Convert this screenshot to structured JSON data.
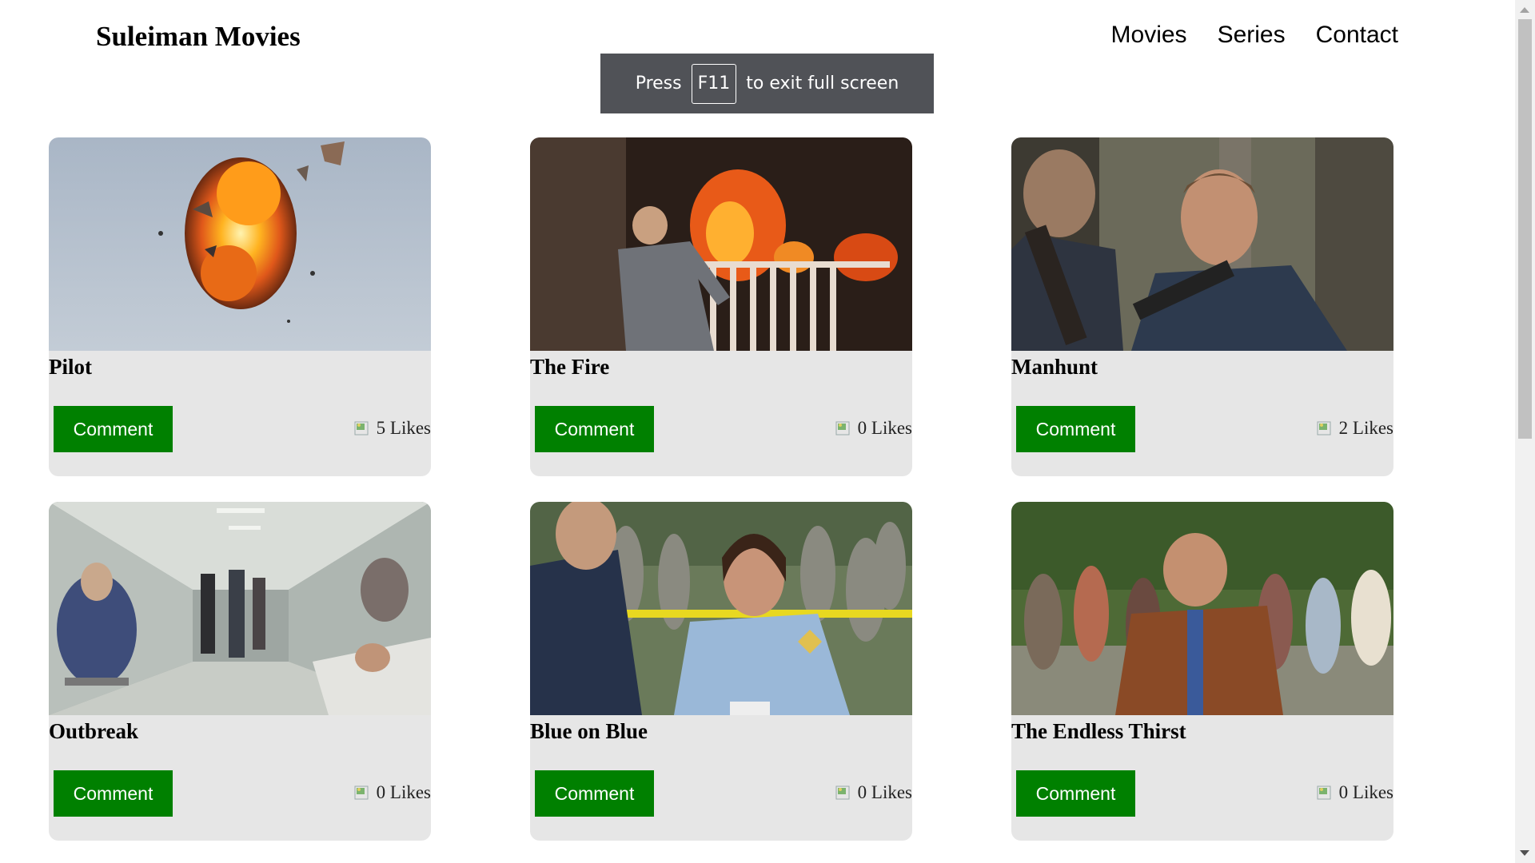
{
  "header": {
    "brand": "Suleiman Movies",
    "nav": [
      "Movies",
      "Series",
      "Contact"
    ]
  },
  "fullscreen_notice": {
    "prefix": "Press",
    "key": "F11",
    "suffix": "to exit full screen"
  },
  "episodes": [
    {
      "title": "Pilot",
      "comment_label": "Comment",
      "likes": "5 Likes",
      "image": "explosion-in-sky",
      "like_icon": "broken-image-icon"
    },
    {
      "title": "The Fire",
      "comment_label": "Comment",
      "likes": "0 Likes",
      "image": "man-by-burning-house",
      "like_icon": "broken-image-icon"
    },
    {
      "title": "Manhunt",
      "comment_label": "Comment",
      "likes": "2 Likes",
      "image": "man-with-rifle-in-woods",
      "like_icon": "broken-image-icon"
    },
    {
      "title": "Outbreak",
      "comment_label": "Comment",
      "likes": "0 Likes",
      "image": "crowded-hospital-corridor",
      "like_icon": "broken-image-icon"
    },
    {
      "title": "Blue on Blue",
      "comment_label": "Comment",
      "likes": "0 Likes",
      "image": "deputy-at-crime-tape",
      "like_icon": "broken-image-icon"
    },
    {
      "title": "The Endless Thirst",
      "comment_label": "Comment",
      "likes": "0 Likes",
      "image": "bald-man-leading-crowd",
      "like_icon": "broken-image-icon"
    }
  ],
  "colors": {
    "comment_button": "#008000",
    "card_background": "#e6e6e6",
    "toast_background": "#505257"
  }
}
